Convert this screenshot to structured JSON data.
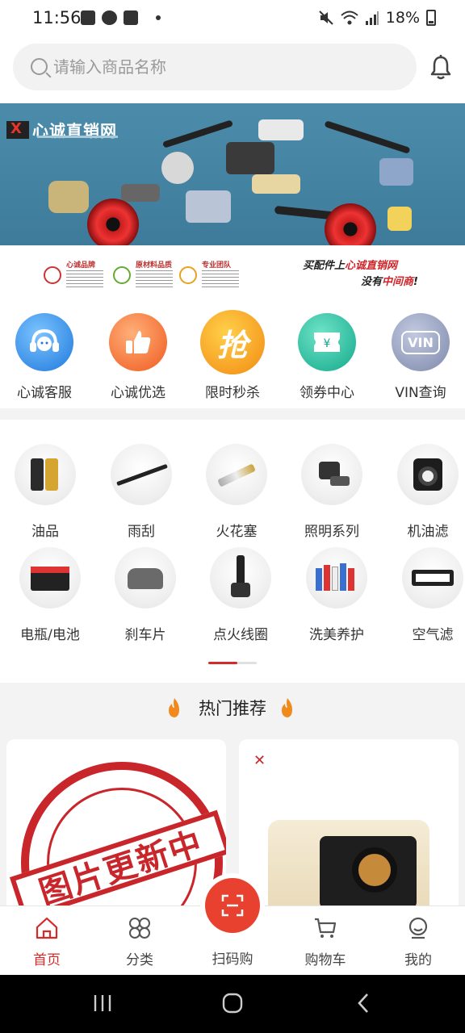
{
  "status_bar": {
    "time": "11:56",
    "battery": "18%"
  },
  "search": {
    "placeholder": "请输入商品名称"
  },
  "banner": {
    "brand_name": "心诚直销网",
    "features": [
      "心诚品牌",
      "原材料品质",
      "专业团队"
    ],
    "slogan_line1_prefix": "买配件上",
    "slogan_line1_brand": "心诚直销网",
    "slogan_line2_prefix": "没有",
    "slogan_line2_red": "中间商",
    "slogan_line2_suffix": "!"
  },
  "quick_menu": [
    {
      "label": "心诚客服",
      "icon": "customer-service-icon",
      "color": "#2f8fe8"
    },
    {
      "label": "心诚优选",
      "icon": "thumbs-up-icon",
      "color": "#f26a2e"
    },
    {
      "label": "限时秒杀",
      "icon": "flash-sale-icon",
      "color": "#f39a1a",
      "glyph": "抢"
    },
    {
      "label": "领券中心",
      "icon": "coupon-icon",
      "color": "#1fb79a"
    },
    {
      "label": "VIN查询",
      "icon": "vin-icon",
      "color": "#8b96b8",
      "glyph": "VIN"
    }
  ],
  "categories": [
    {
      "label": "油品",
      "icon": "engine-oil-icon"
    },
    {
      "label": "雨刮",
      "icon": "wiper-icon"
    },
    {
      "label": "火花塞",
      "icon": "spark-plug-icon"
    },
    {
      "label": "照明系列",
      "icon": "headlight-bulb-icon"
    },
    {
      "label": "机油滤",
      "icon": "oil-filter-icon"
    },
    {
      "label": "电瓶/电池",
      "icon": "battery-icon"
    },
    {
      "label": "刹车片",
      "icon": "brake-pad-icon"
    },
    {
      "label": "点火线圈",
      "icon": "ignition-coil-icon"
    },
    {
      "label": "洗美养护",
      "icon": "car-care-icon"
    },
    {
      "label": "空气滤",
      "icon": "air-filter-icon"
    }
  ],
  "hot": {
    "title": "热门推荐",
    "card1_stamp": "图片更新中"
  },
  "bottom_nav": {
    "items": [
      {
        "label": "首页",
        "icon": "home-icon",
        "active": true
      },
      {
        "label": "分类",
        "icon": "category-icon",
        "active": false
      },
      {
        "label": "扫码购",
        "icon": "scan-icon",
        "active": false
      },
      {
        "label": "购物车",
        "icon": "cart-icon",
        "active": false
      },
      {
        "label": "我的",
        "icon": "profile-icon",
        "active": false
      }
    ]
  },
  "colors": {
    "accent": "#d62a2a",
    "banner_bg": "#4c8cab"
  }
}
